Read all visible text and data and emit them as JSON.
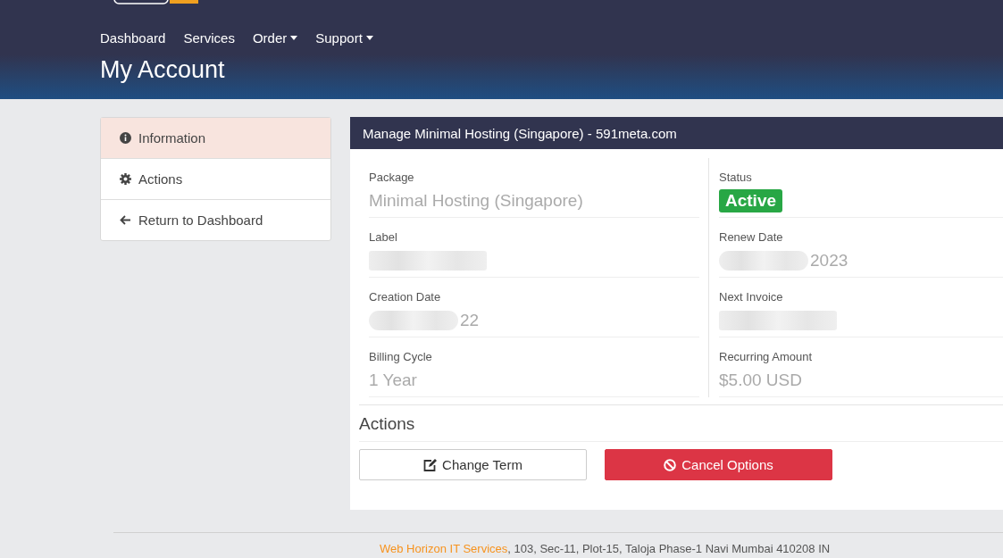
{
  "nav": [
    {
      "label": "Dashboard",
      "dropdown": false
    },
    {
      "label": "Services",
      "dropdown": false
    },
    {
      "label": "Order",
      "dropdown": true
    },
    {
      "label": "Support",
      "dropdown": true
    }
  ],
  "page_title": "My Account",
  "sidebar": [
    {
      "label": "Information",
      "kind": "info",
      "selected": true
    },
    {
      "label": "Actions",
      "kind": "gear",
      "selected": false
    },
    {
      "label": "Return to Dashboard",
      "kind": "back",
      "selected": false
    }
  ],
  "panel_title": "Manage Minimal Hosting (Singapore) - 591meta.com",
  "left_fields": [
    {
      "label": "Package",
      "kind": "text",
      "value": "Minimal Hosting (Singapore)"
    },
    {
      "label": "Label",
      "kind": "redacted"
    },
    {
      "label": "Creation Date",
      "kind": "partial",
      "value": "22"
    },
    {
      "label": "Billing Cycle",
      "kind": "text",
      "value": "1 Year"
    }
  ],
  "right_fields": [
    {
      "label": "Status",
      "kind": "badge",
      "value": "Active"
    },
    {
      "label": "Renew Date",
      "kind": "partial",
      "value": "2023"
    },
    {
      "label": "Next Invoice",
      "kind": "redacted"
    },
    {
      "label": "Recurring Amount",
      "kind": "text",
      "value": "$5.00 USD"
    }
  ],
  "actions_title": "Actions",
  "buttons": [
    {
      "label": "Change Term",
      "kind": "default"
    },
    {
      "label": "Cancel Options",
      "kind": "danger"
    }
  ],
  "footer": {
    "company": "Web Horizon IT Services",
    "address": ", 103, Sec-11, Plot-15, Taloja Phase-1 Navi Mumbai 410208 IN"
  }
}
